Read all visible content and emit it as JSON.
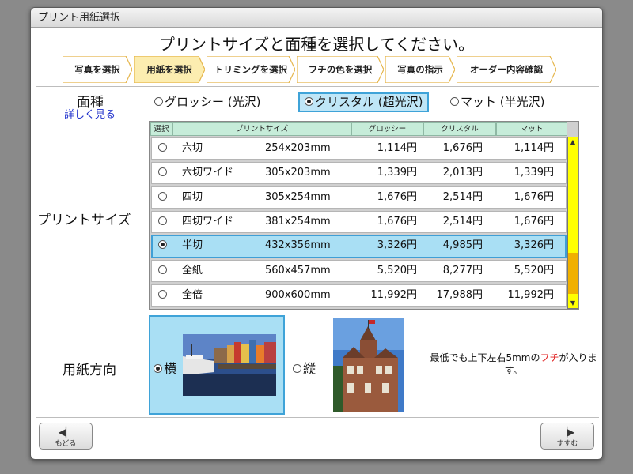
{
  "window": {
    "title": "プリント用紙選択"
  },
  "heading": "プリントサイズと面種を選択してください。",
  "steps": [
    {
      "label": "写真を選択",
      "active": false
    },
    {
      "label": "用紙を選択",
      "active": true
    },
    {
      "label": "トリミングを選択",
      "active": false
    },
    {
      "label": "フチの色を選択",
      "active": false
    },
    {
      "label": "写真の指示",
      "active": false
    },
    {
      "label": "オーダー内容確認",
      "active": false
    }
  ],
  "finish": {
    "label": "面種",
    "detail_link": "詳しく見る",
    "options": [
      {
        "label": "グロッシー (光沢)",
        "selected": false
      },
      {
        "label": "クリスタル (超光沢)",
        "selected": true
      },
      {
        "label": "マット (半光沢)",
        "selected": false
      }
    ]
  },
  "print_size": {
    "label": "プリントサイズ",
    "headers": [
      "選択",
      "プリントサイズ",
      "グロッシー",
      "クリスタル",
      "マット"
    ],
    "rows": [
      {
        "name": "六切",
        "size": "254x203mm",
        "glossy": "1,114円",
        "crystal": "1,676円",
        "matte": "1,114円",
        "selected": false
      },
      {
        "name": "六切ワイド",
        "size": "305x203mm",
        "glossy": "1,339円",
        "crystal": "2,013円",
        "matte": "1,339円",
        "selected": false
      },
      {
        "name": "四切",
        "size": "305x254mm",
        "glossy": "1,676円",
        "crystal": "2,514円",
        "matte": "1,676円",
        "selected": false
      },
      {
        "name": "四切ワイド",
        "size": "381x254mm",
        "glossy": "1,676円",
        "crystal": "2,514円",
        "matte": "1,676円",
        "selected": false
      },
      {
        "name": "半切",
        "size": "432x356mm",
        "glossy": "3,326円",
        "crystal": "4,985円",
        "matte": "3,326円",
        "selected": true
      },
      {
        "name": "全紙",
        "size": "560x457mm",
        "glossy": "5,520円",
        "crystal": "8,277円",
        "matte": "5,520円",
        "selected": false
      },
      {
        "name": "全倍",
        "size": "900x600mm",
        "glossy": "11,992円",
        "crystal": "17,988円",
        "matte": "11,992円",
        "selected": false
      }
    ]
  },
  "orientation": {
    "label": "用紙方向",
    "landscape": {
      "label": "横",
      "selected": true
    },
    "portrait": {
      "label": "縦",
      "selected": false
    }
  },
  "note": {
    "before": "最低でも上下左右5mmの",
    "highlight": "フチ",
    "after": "が入ります。"
  },
  "nav": {
    "back_label": "もどる",
    "next_label": "すすむ"
  },
  "colors": {
    "selected_fill": "#a9dff4",
    "selected_border": "#3f9fd6",
    "active_step": "#fcedb0",
    "scrollbar": "#ffff00",
    "note_red": "#e02020"
  }
}
